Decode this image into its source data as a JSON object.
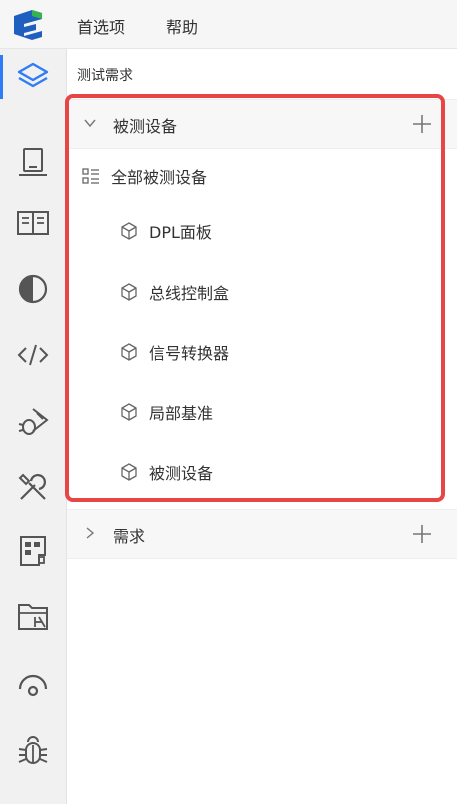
{
  "menubar": {
    "logo": "app-logo-icon",
    "items": [
      {
        "label": "首选项"
      },
      {
        "label": "帮助"
      }
    ]
  },
  "activitybar": {
    "active_color": "#2f7cf6",
    "items": [
      {
        "icon": "layers-icon",
        "active": true
      },
      {
        "icon": "device-icon"
      },
      {
        "icon": "book-icon"
      },
      {
        "icon": "contrast-icon"
      },
      {
        "icon": "code-icon"
      },
      {
        "icon": "bug-run-icon"
      },
      {
        "icon": "tools-icon"
      },
      {
        "icon": "report-icon"
      },
      {
        "icon": "folder-tree-icon"
      },
      {
        "icon": "signal-icon"
      },
      {
        "icon": "bug-icon"
      }
    ]
  },
  "panel": {
    "title": "测试需求",
    "sections": [
      {
        "label": "被测设备",
        "expanded": true,
        "root": "全部被测设备",
        "items": [
          "DPL面板",
          "总线控制盒",
          "信号转换器",
          "局部基准",
          "被测设备"
        ]
      },
      {
        "label": "需求",
        "expanded": false
      }
    ]
  },
  "highlight_color": "#e84545"
}
